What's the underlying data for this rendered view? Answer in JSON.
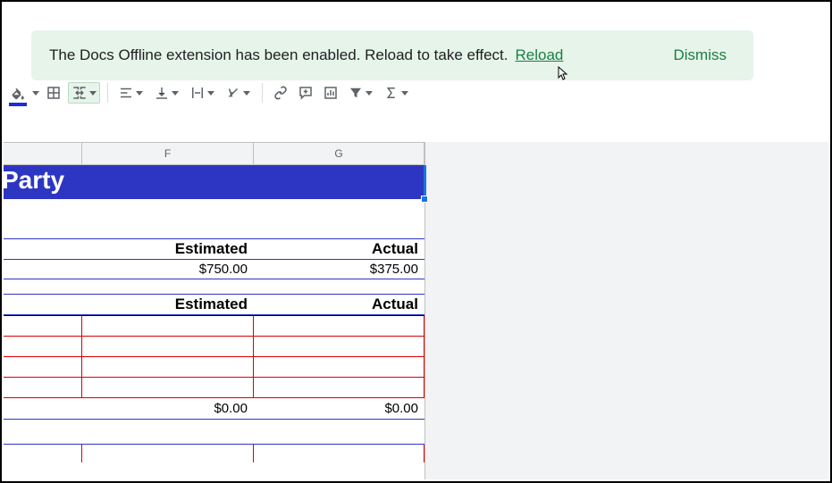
{
  "notification": {
    "message": "The Docs Offline extension has been enabled. Reload to take effect.",
    "reload_label": "Reload",
    "dismiss_label": "Dismiss"
  },
  "toolbar": {
    "paint_color": "#1a2dd8"
  },
  "columns": {
    "f_label": "F",
    "g_label": "G"
  },
  "sheet": {
    "title": "Party",
    "section1": {
      "header_f": "Estimated",
      "header_g": "Actual",
      "value_f": "$750.00",
      "value_g": "$375.00"
    },
    "section2": {
      "header_f": "Estimated",
      "header_g": "Actual",
      "total_f": "$0.00",
      "total_g": "$0.00"
    }
  }
}
